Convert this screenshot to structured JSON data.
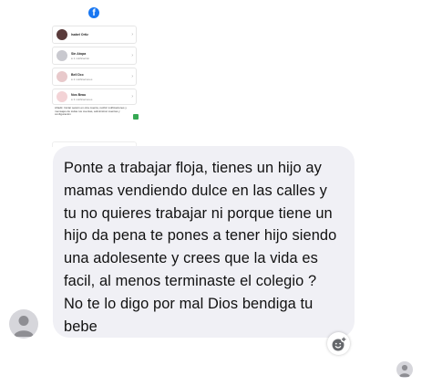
{
  "shared_post": {
    "facebook_logo": "facebook-logo",
    "accounts": [
      {
        "name": "Isabel Ortiz",
        "sub": ""
      },
      {
        "name": "Sin Atopa",
        "sub": "● 1 notificación"
      },
      {
        "name": "Bell Dcc",
        "sub": "● 2 notificaciones"
      },
      {
        "name": "Nos Beau",
        "sub": "● 3 notificaciones"
      }
    ],
    "fine_print": "Añadir, Iniciar sesión en otra cuenta, recibir notificaciones y mensajes de todas tus cuentas, administrar cuentas y configuración"
  },
  "message": {
    "text": "Ponte a trabajar floja, tienes un hijo ay\nmamas vendiendo dulce en las calles y\ntu no quieres trabajar ni porque tiene un\nhijo da pena te pones a tener hijo siendo\nuna adolesente y crees que la vida es\nfacil, al menos terminaste el colegio ?\nNo te lo digo por mal Dios bendiga tu\nbebe"
  },
  "icons": {
    "sender_avatar": "default-avatar-icon",
    "reaction": "add-reaction-icon",
    "seen_avatar": "seen-avatar-icon"
  },
  "colors": {
    "bubble": "#f0f0f5",
    "facebook_blue": "#1877f2",
    "avatar_gray": "#d6d6db"
  }
}
